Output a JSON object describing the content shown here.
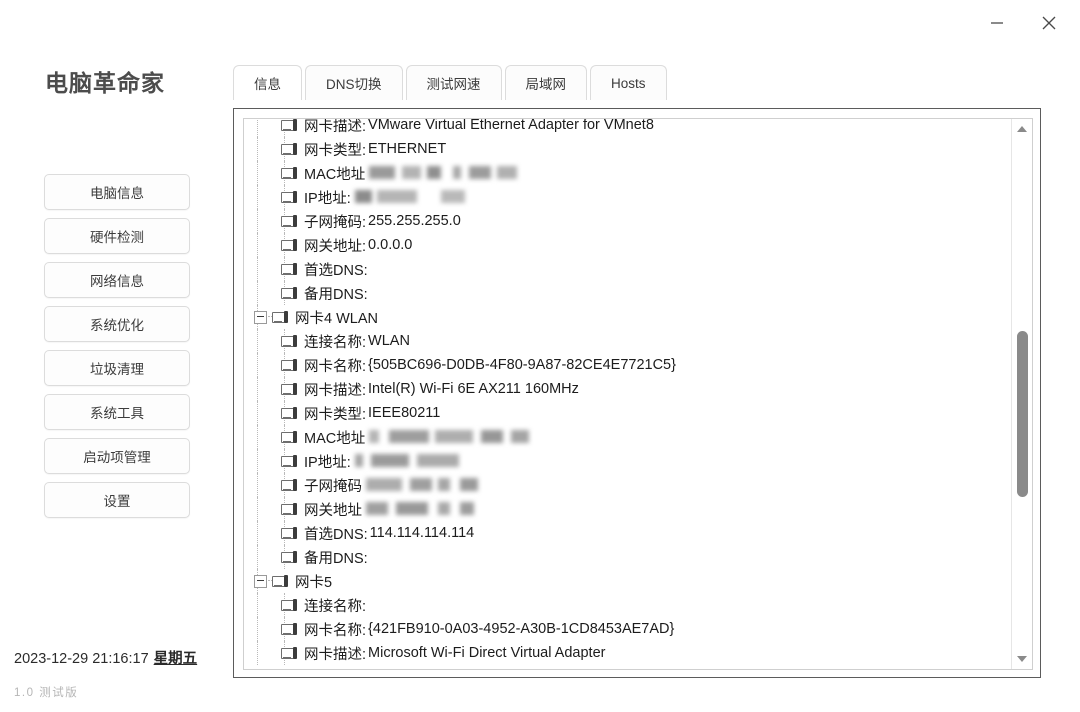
{
  "window": {
    "minimize_label": "—",
    "close_label": "×"
  },
  "sidebar": {
    "app_title": "电脑革命家",
    "items": [
      {
        "label": "电脑信息"
      },
      {
        "label": "硬件检测"
      },
      {
        "label": "网络信息"
      },
      {
        "label": "系统优化"
      },
      {
        "label": "垃圾清理"
      },
      {
        "label": "系统工具"
      },
      {
        "label": "启动项管理"
      },
      {
        "label": "设置"
      }
    ],
    "status": {
      "datetime": "2023-12-29 21:16:17",
      "weekday": "星期五",
      "version": "1.0",
      "build": "测试版"
    }
  },
  "tabs": [
    {
      "label": "信息",
      "active": true
    },
    {
      "label": "DNS切换",
      "active": false
    },
    {
      "label": "测试网速",
      "active": false
    },
    {
      "label": "局域网",
      "active": false
    },
    {
      "label": "Hosts",
      "active": false
    }
  ],
  "tree": {
    "rows": [
      {
        "level": 1,
        "label": "网卡描述:",
        "value": "VMware Virtual Ethernet Adapter for VMnet8",
        "redacted": false
      },
      {
        "level": 1,
        "label": "网卡类型:",
        "value": "ETHERNET",
        "redacted": false
      },
      {
        "level": 1,
        "label": "MAC地址",
        "value": "",
        "redacted": true,
        "redact_style": "rd-a"
      },
      {
        "level": 1,
        "label": "IP地址:",
        "value": "",
        "redacted": true,
        "redact_style": "rd-b"
      },
      {
        "level": 1,
        "label": "子网掩码:",
        "value": "255.255.255.0",
        "redacted": false
      },
      {
        "level": 1,
        "label": "网关地址:",
        "value": "0.0.0.0",
        "redacted": false
      },
      {
        "level": 1,
        "label": "首选DNS:",
        "value": "",
        "redacted": false
      },
      {
        "level": 1,
        "label": "备用DNS:",
        "value": "",
        "redacted": false
      },
      {
        "level": 0,
        "label": "网卡4 WLAN",
        "value": "",
        "redacted": false,
        "group": true
      },
      {
        "level": 1,
        "label": "连接名称:",
        "value": "WLAN",
        "redacted": false
      },
      {
        "level": 1,
        "label": "网卡名称:",
        "value": "{505BC696-D0DB-4F80-9A87-82CE4E7721C5}",
        "redacted": false
      },
      {
        "level": 1,
        "label": "网卡描述:",
        "value": "Intel(R) Wi-Fi 6E AX211 160MHz",
        "redacted": false
      },
      {
        "level": 1,
        "label": "网卡类型:",
        "value": "IEEE80211",
        "redacted": false
      },
      {
        "level": 1,
        "label": "MAC地址",
        "value": "",
        "redacted": true,
        "redact_style": "rd-c"
      },
      {
        "level": 1,
        "label": "IP地址:",
        "value": "",
        "redacted": true,
        "redact_style": "rd-d"
      },
      {
        "level": 1,
        "label": "子网掩码",
        "value": "",
        "redacted": true,
        "redact_style": "rd-e"
      },
      {
        "level": 1,
        "label": "网关地址",
        "value": "",
        "redacted": true,
        "redact_style": "rd-f"
      },
      {
        "level": 1,
        "label": "首选DNS:",
        "value": "114.114.114.114",
        "redacted": false
      },
      {
        "level": 1,
        "label": "备用DNS:",
        "value": "",
        "redacted": false
      },
      {
        "level": 0,
        "label": "网卡5",
        "value": "",
        "redacted": false,
        "group": true
      },
      {
        "level": 1,
        "label": "连接名称:",
        "value": "",
        "redacted": false
      },
      {
        "level": 1,
        "label": "网卡名称:",
        "value": "{421FB910-0A03-4952-A30B-1CD8453AE7AD}",
        "redacted": false
      },
      {
        "level": 1,
        "label": "网卡描述:",
        "value": "Microsoft Wi-Fi Direct Virtual Adapter",
        "redacted": false
      }
    ]
  },
  "colors": {
    "panel_border": "#5b5b5b",
    "button_border": "#dcdcdc",
    "text": "#1c1c1c",
    "muted": "#b6b6b6",
    "scrollbar_thumb": "#8a8a8a"
  }
}
